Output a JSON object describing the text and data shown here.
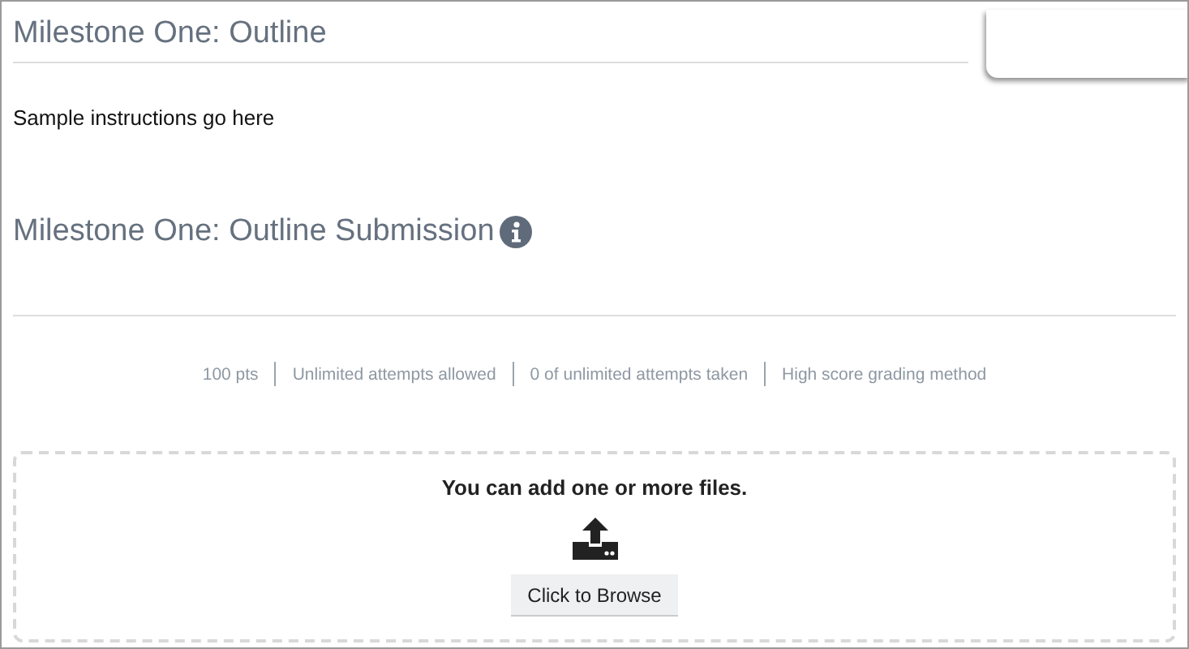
{
  "title": "Milestone One: Outline",
  "instructions": "Sample instructions go here",
  "submission": {
    "heading": "Milestone One: Outline Submission",
    "meta": [
      "100 pts",
      "Unlimited attempts allowed",
      "0 of unlimited attempts taken",
      "High score grading method"
    ],
    "dropzone": {
      "message": "You can add one or more files.",
      "button": "Click to Browse"
    }
  }
}
